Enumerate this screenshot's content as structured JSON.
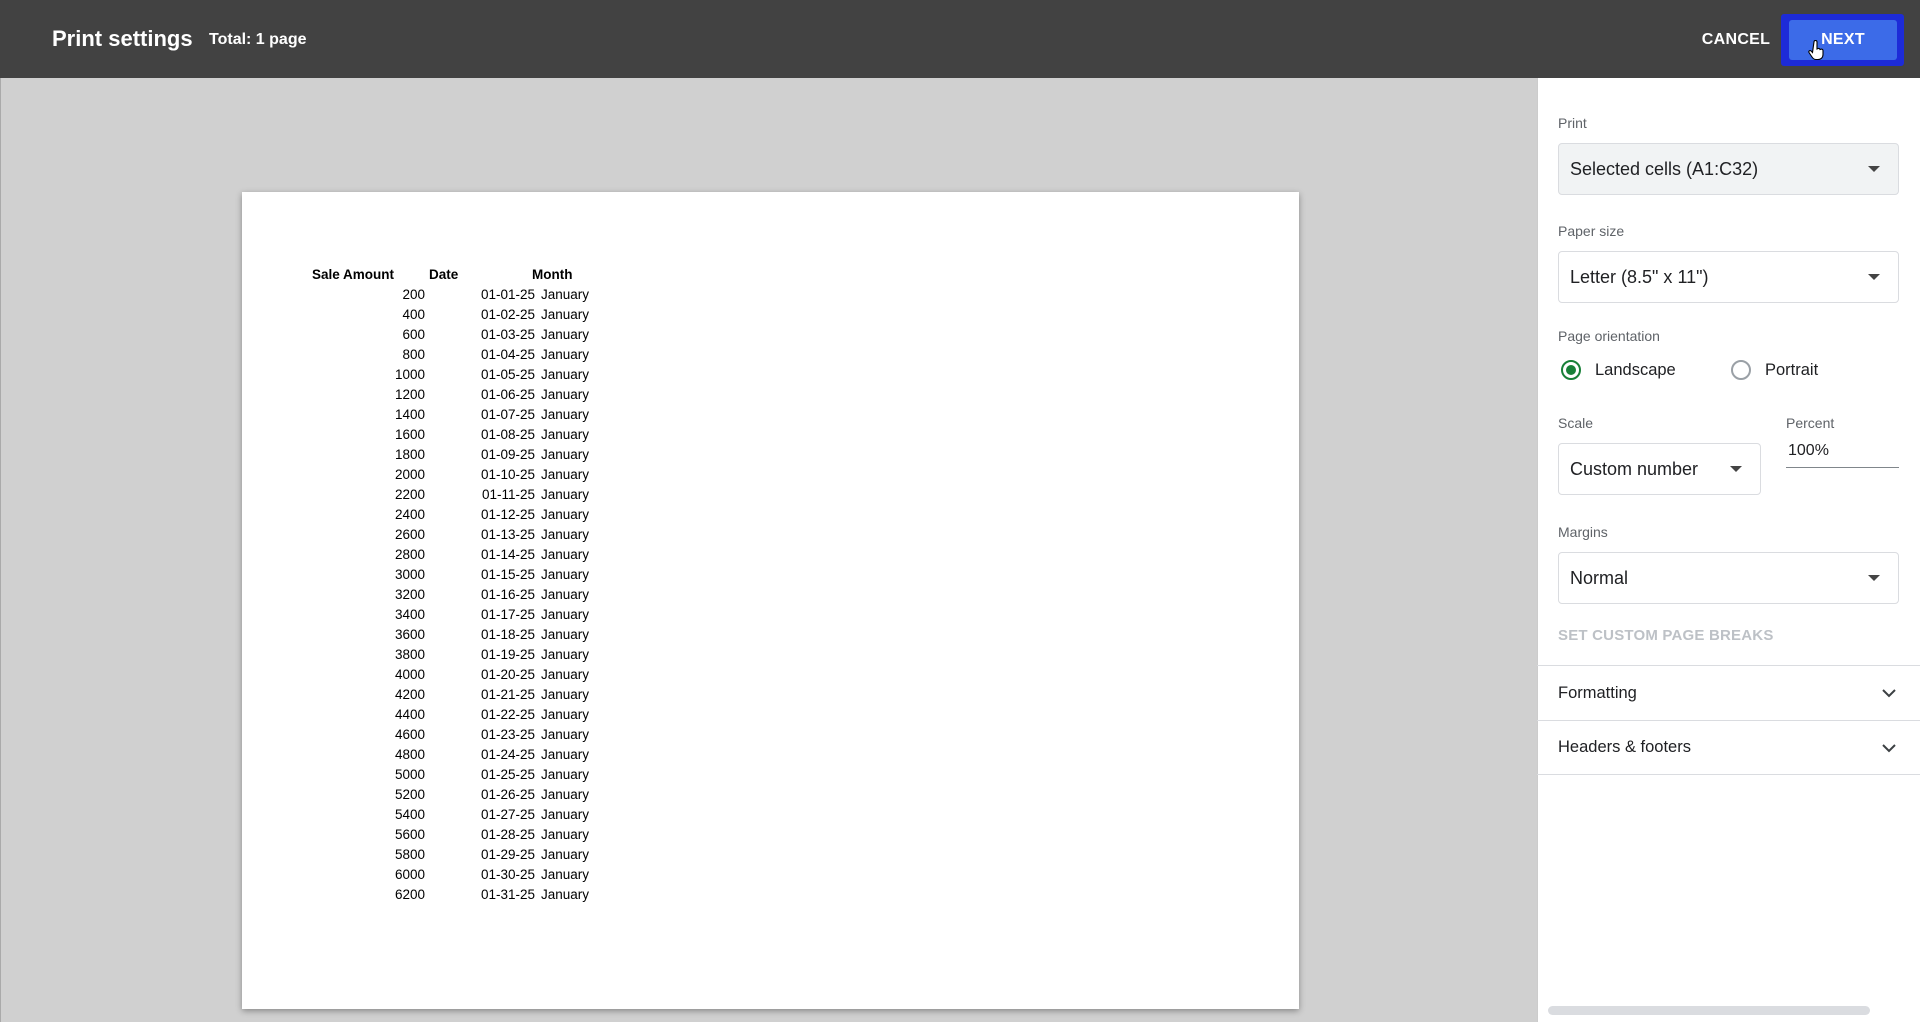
{
  "header": {
    "title": "Print settings",
    "total": "Total: 1 page",
    "cancel_label": "CANCEL",
    "next_label": "NEXT"
  },
  "sheet": {
    "columns": [
      "Sale Amount",
      "Date",
      "Month"
    ],
    "rows": [
      [
        "200",
        "01-01-25",
        "January"
      ],
      [
        "400",
        "01-02-25",
        "January"
      ],
      [
        "600",
        "01-03-25",
        "January"
      ],
      [
        "800",
        "01-04-25",
        "January"
      ],
      [
        "1000",
        "01-05-25",
        "January"
      ],
      [
        "1200",
        "01-06-25",
        "January"
      ],
      [
        "1400",
        "01-07-25",
        "January"
      ],
      [
        "1600",
        "01-08-25",
        "January"
      ],
      [
        "1800",
        "01-09-25",
        "January"
      ],
      [
        "2000",
        "01-10-25",
        "January"
      ],
      [
        "2200",
        "01-11-25",
        "January"
      ],
      [
        "2400",
        "01-12-25",
        "January"
      ],
      [
        "2600",
        "01-13-25",
        "January"
      ],
      [
        "2800",
        "01-14-25",
        "January"
      ],
      [
        "3000",
        "01-15-25",
        "January"
      ],
      [
        "3200",
        "01-16-25",
        "January"
      ],
      [
        "3400",
        "01-17-25",
        "January"
      ],
      [
        "3600",
        "01-18-25",
        "January"
      ],
      [
        "3800",
        "01-19-25",
        "January"
      ],
      [
        "4000",
        "01-20-25",
        "January"
      ],
      [
        "4200",
        "01-21-25",
        "January"
      ],
      [
        "4400",
        "01-22-25",
        "January"
      ],
      [
        "4600",
        "01-23-25",
        "January"
      ],
      [
        "4800",
        "01-24-25",
        "January"
      ],
      [
        "5000",
        "01-25-25",
        "January"
      ],
      [
        "5200",
        "01-26-25",
        "January"
      ],
      [
        "5400",
        "01-27-25",
        "January"
      ],
      [
        "5600",
        "01-28-25",
        "January"
      ],
      [
        "5800",
        "01-29-25",
        "January"
      ],
      [
        "6000",
        "01-30-25",
        "January"
      ],
      [
        "6200",
        "01-31-25",
        "January"
      ]
    ]
  },
  "settings": {
    "print_label": "Print",
    "print_value": "Selected cells (A1:C32)",
    "paper_label": "Paper size",
    "paper_value": "Letter (8.5\" x 11\")",
    "orientation_label": "Page orientation",
    "landscape_label": "Landscape",
    "portrait_label": "Portrait",
    "orientation_selected": "Landscape",
    "scale_label": "Scale",
    "scale_value": "Custom number",
    "percent_label": "Percent",
    "percent_value": "100%",
    "margins_label": "Margins",
    "margins_value": "Normal",
    "page_breaks_label": "SET CUSTOM PAGE BREAKS",
    "formatting_label": "Formatting",
    "headers_label": "Headers & footers"
  },
  "colors": {
    "topbar": "#424242",
    "next_button": "#3c6be8",
    "radio_selected": "#188038"
  },
  "icons": [
    "dropdown-caret-icon",
    "chevron-down-icon",
    "hand-cursor-icon"
  ]
}
